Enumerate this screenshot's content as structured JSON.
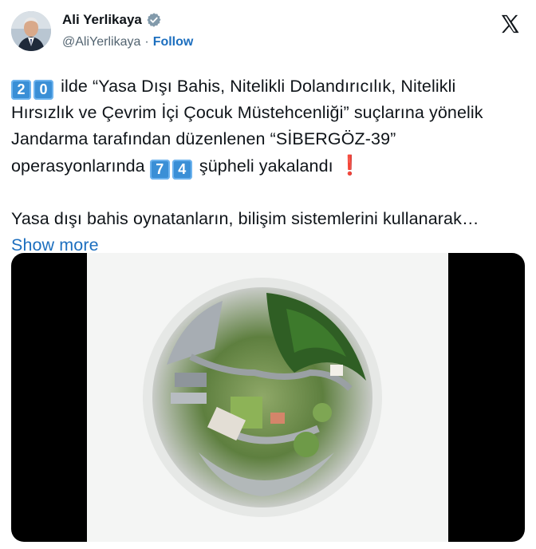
{
  "author": {
    "name": "Ali Yerlikaya",
    "handle": "@AliYerlikaya",
    "separator": "·",
    "follow_label": "Follow",
    "verified_icon": "verified-badge-icon",
    "avatar_icon": "avatar"
  },
  "platform_icon": "x-logo-icon",
  "tweet": {
    "num_a": [
      "2",
      "0"
    ],
    "text_1": " ilde “Yasa Dışı Bahis, Nitelikli Dolandırıcılık, Nitelikli Hırsızlık ve Çevrim İçi Çocuk Müstehcenliği” suçlarına yönelik Jandarma tarafından düzenlenen “SİBERGÖZ-39” operasyonlarında ",
    "num_b": [
      "7",
      "4"
    ],
    "text_2": " şüpheli yakalandı ",
    "exclamation": "❗",
    "text_3": "Yasa dışı bahis oynatanların, bilişim sistemlerini kullanarak… ",
    "show_more": "Show more"
  },
  "colors": {
    "link": "#1d6fbf",
    "keycap": "#3a8fd6",
    "text": "#0f1419",
    "secondary": "#536471"
  }
}
